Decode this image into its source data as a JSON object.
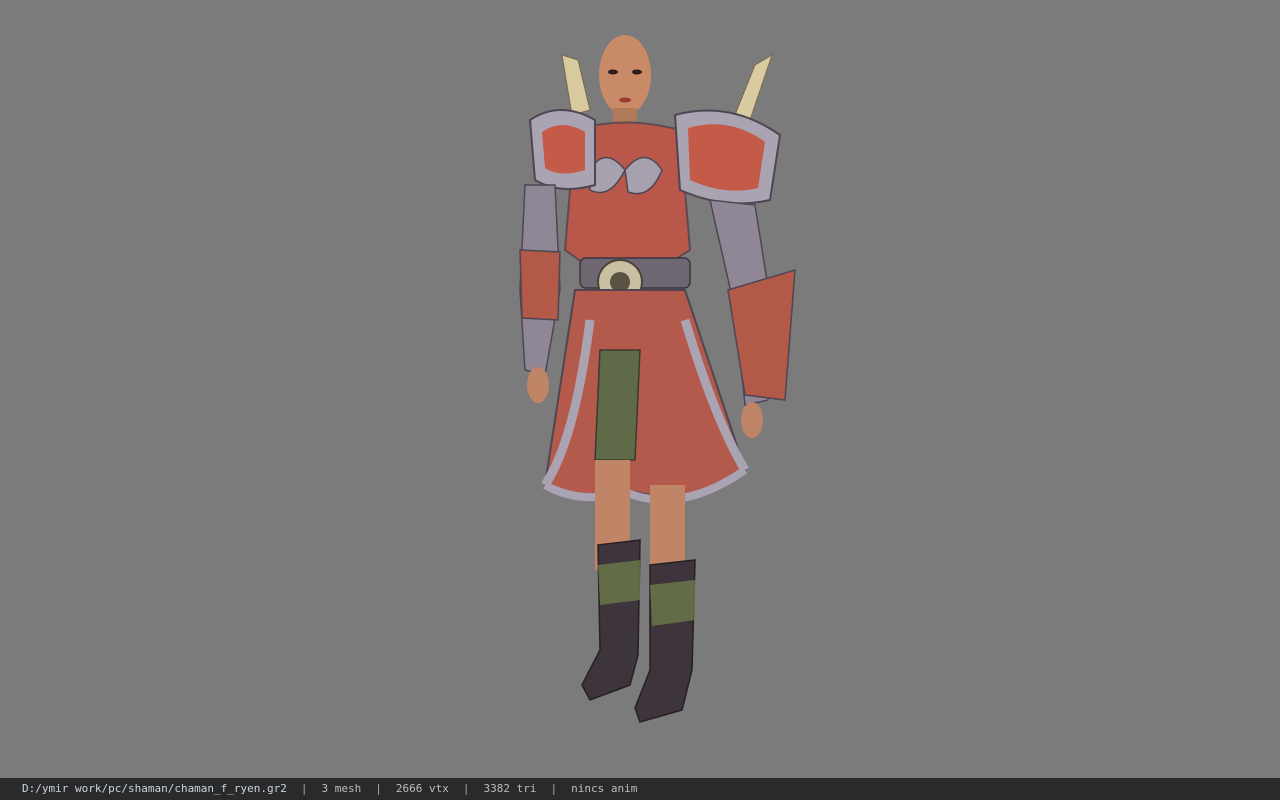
{
  "viewer": {
    "background_color": "#7b7b7b",
    "model_name": "shaman-female-armored-character"
  },
  "status": {
    "path": "D:/ymir work/pc/shaman/chaman_f_ryen.gr2",
    "mesh": "3 mesh",
    "vtx": "2666 vtx",
    "tri": "3382 tri",
    "anim": "nincs anim",
    "separator": "|"
  }
}
